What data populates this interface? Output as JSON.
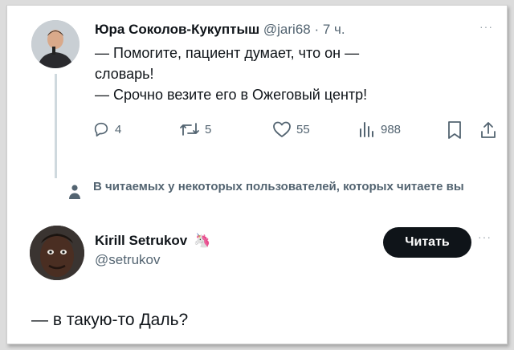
{
  "tweet1": {
    "name": "Юра Соколов-Кукуптыш",
    "handle": "@jari68",
    "separator": "·",
    "time": "7 ч.",
    "more": "···",
    "lines": [
      "— Помогите, пациент думает, что он —",
      "словарь!",
      "— Срочно везите его в Ожеговый центр!"
    ],
    "actions": {
      "replies": "4",
      "retweets": "5",
      "likes": "55",
      "views": "988"
    }
  },
  "notice": {
    "text": "В читаемых у некоторых пользователей, которых читаете вы"
  },
  "tweet2": {
    "name": "Kirill Setrukov",
    "emoji": "🦄",
    "handle": "@setrukov",
    "follow_label": "Читать",
    "more": "···",
    "body": "— в такую-то Даль?"
  },
  "icons": {
    "reply": "reply-icon",
    "retweet": "retweet-icon",
    "like": "heart-icon",
    "views": "views-icon",
    "bookmark": "bookmark-icon",
    "share": "share-icon",
    "notice": "person-icon"
  },
  "colors": {
    "text": "#0f1419",
    "secondary": "#536471",
    "button_bg": "#0f1419",
    "thread_line": "#cfd9de"
  }
}
